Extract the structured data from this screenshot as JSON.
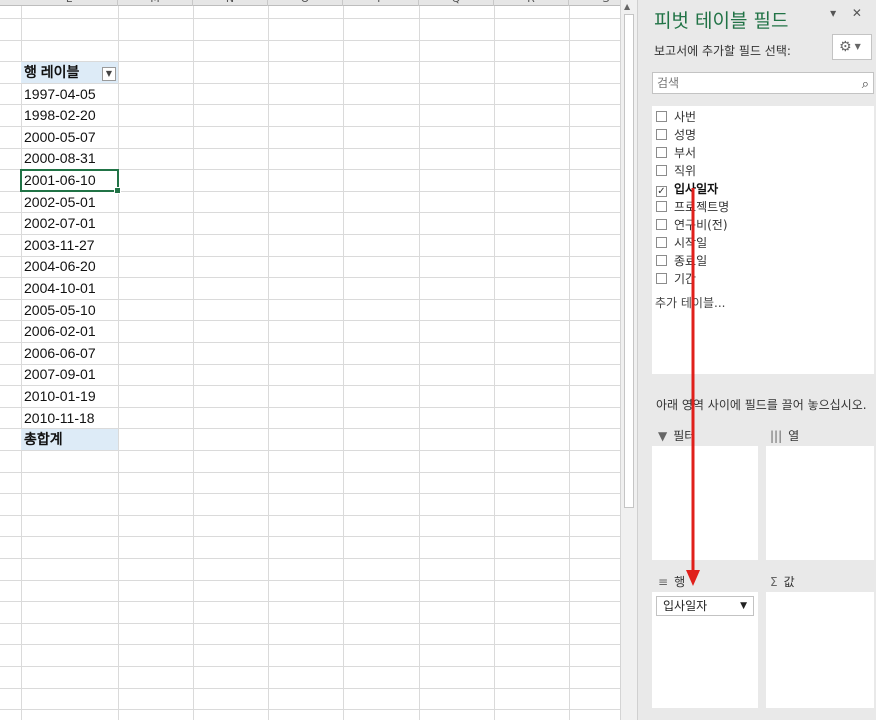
{
  "sheet": {
    "columns": [
      "L",
      "M",
      "N",
      "O",
      "P",
      "Q",
      "R",
      "S"
    ],
    "pivot": {
      "header": "행 레이블",
      "rows": [
        "1997-04-05",
        "1998-02-20",
        "2000-05-07",
        "2000-08-31",
        "2001-06-10",
        "2002-05-01",
        "2002-07-01",
        "2003-11-27",
        "2004-06-20",
        "2004-10-01",
        "2005-05-10",
        "2006-02-01",
        "2006-06-07",
        "2007-09-01",
        "2010-01-19",
        "2010-11-18"
      ],
      "total": "총합계",
      "selected_row": "2001-06-10"
    }
  },
  "pane": {
    "title": "피벗 테이블 필드",
    "close_glyphs": "▾ ✕",
    "choose_label": "보고서에 추가할 필드 선택:",
    "gear_icon": "⚙",
    "search_placeholder": "검색",
    "search_icon": "⚲",
    "fields": [
      {
        "label": "사번",
        "checked": false
      },
      {
        "label": "성명",
        "checked": false
      },
      {
        "label": "부서",
        "checked": false
      },
      {
        "label": "직위",
        "checked": false
      },
      {
        "label": "입사일자",
        "checked": true
      },
      {
        "label": "프로젝트명",
        "checked": false
      },
      {
        "label": "연구비(전)",
        "checked": false
      },
      {
        "label": "시작일",
        "checked": false
      },
      {
        "label": "종료일",
        "checked": false
      },
      {
        "label": "기간",
        "checked": false
      }
    ],
    "more_tables": "추가 테이블...",
    "drag_hint": "아래 영역 사이에 필드를 끌어 놓으십시오.",
    "areas": {
      "filter": {
        "icon": "▼",
        "label": "필터"
      },
      "columns": {
        "icon": "|||",
        "label": "열"
      },
      "rows": {
        "icon": "≡",
        "label": "행",
        "field": "입사일자"
      },
      "values": {
        "icon": "Σ",
        "label": "값"
      }
    },
    "annotation_color": "#e0201b",
    "accent_color": "#217346"
  }
}
